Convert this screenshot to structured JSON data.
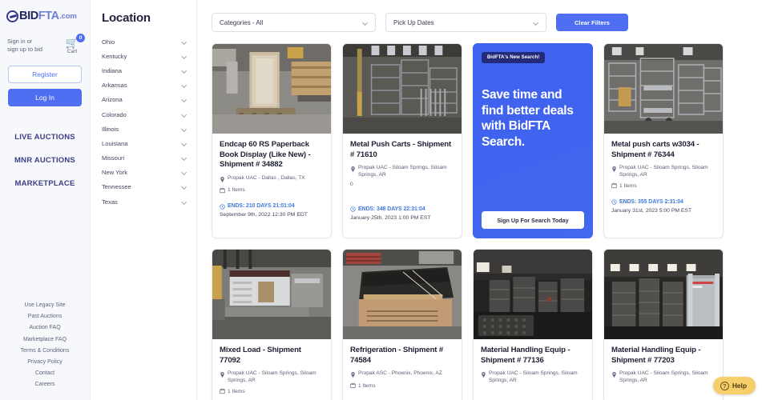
{
  "sidebar": {
    "logo": {
      "bid": "BID",
      "fta": "FTA",
      "com": ".com",
      "icon": "bidfta-logo-icon"
    },
    "signin_text": "Sign in or\nsign up to bid",
    "cart": {
      "label": "Cart",
      "count": "0",
      "icon": "shopping-cart-icon"
    },
    "register_label": "Register",
    "login_label": "Log In",
    "nav": [
      {
        "label": "LIVE AUCTIONS"
      },
      {
        "label": "MNR AUCTIONS"
      },
      {
        "label": "MARKETPLACE"
      }
    ],
    "footer": [
      {
        "label": "Use Legacy Site"
      },
      {
        "label": "Past Auctions"
      },
      {
        "label": "Auction FAQ"
      },
      {
        "label": "Marketplace FAQ"
      },
      {
        "label": "Terms & Conditions"
      },
      {
        "label": "Privacy Policy"
      },
      {
        "label": "Contact"
      },
      {
        "label": "Careers"
      }
    ]
  },
  "location": {
    "title": "Location",
    "items": [
      {
        "label": "Ohio"
      },
      {
        "label": "Kentucky"
      },
      {
        "label": "Indiana"
      },
      {
        "label": "Arkansas"
      },
      {
        "label": "Arizona"
      },
      {
        "label": "Colorado"
      },
      {
        "label": "Illinois"
      },
      {
        "label": "Louisiana"
      },
      {
        "label": "Missouri"
      },
      {
        "label": "New York"
      },
      {
        "label": "Tennessee"
      },
      {
        "label": "Texas"
      }
    ]
  },
  "filters": {
    "categories_value": "Categories - All",
    "dates_value": "Pick Up Dates",
    "clear_label": "Clear Filters"
  },
  "cards": [
    {
      "title": "Endcap 60 RS Paperback Book Display (Like New) - Shipment # 34882",
      "location": "Propak UAC - Dallas , Dallas, TX",
      "items": "1 Items",
      "ends": "ENDS: 210 DAYS 21:01:04",
      "date": "September 9th, 2022 12:30 PM EDT",
      "image": "pallet-wrapped-display-photo"
    },
    {
      "title": "Metal Push Carts - Shipment # 71610",
      "location": "Propak UAC - Siloam Springs, Siloam Springs, AR",
      "items": "0",
      "ends": "ENDS: 348 DAYS 22:31:04",
      "date": "January 25th, 2023 1:00 PM EST",
      "image": "metal-push-carts-photo"
    },
    {
      "title": "Metal push carts w3034 - Shipment # 76344",
      "location": "Propak UAC - Siloam Springs, Siloam Springs, AR",
      "items": "1 Items",
      "ends": "ENDS: 355 DAYS 2:31:04",
      "date": "January 31st, 2023 5:00 PM EST",
      "image": "metal-carts-warehouse-photo"
    },
    {
      "title": "Mixed Load - Shipment 77092",
      "location": "Propak UAC - Siloam Springs, Siloam Springs, AR",
      "items": "1 Items",
      "ends": "",
      "date": "",
      "image": "mixed-load-desk-photo"
    },
    {
      "title": "Refrigeration - Shipment # 74584",
      "location": "Propak ASC - Phoenix, Phoenix, AZ",
      "items": "1 Items",
      "ends": "",
      "date": "",
      "image": "refrigeration-case-photo"
    },
    {
      "title": "Material Handling Equip - Shipment # 77136",
      "location": "Propak UAC - Siloam Springs, Siloam Springs, AR",
      "items": "",
      "ends": "",
      "date": "",
      "image": "material-handling-warehouse-photo"
    },
    {
      "title": "Material Handling Equip - Shipment # 77203",
      "location": "Propak UAC - Siloam Springs, Siloam Springs, AR",
      "items": "",
      "ends": "",
      "date": "",
      "image": "material-handling-racks-photo"
    }
  ],
  "promo": {
    "tag": "BidFTA's New Search!",
    "headline": "Save time and find better deals with BidFTA Search.",
    "button": "Sign Up For Search Today"
  },
  "help": {
    "label": "Help",
    "icon": "question-mark-icon"
  },
  "colors": {
    "accent": "#4f6ef2",
    "promo": "#3f63ef",
    "link": "#3f7ae0",
    "help": "#f7cf6a"
  }
}
